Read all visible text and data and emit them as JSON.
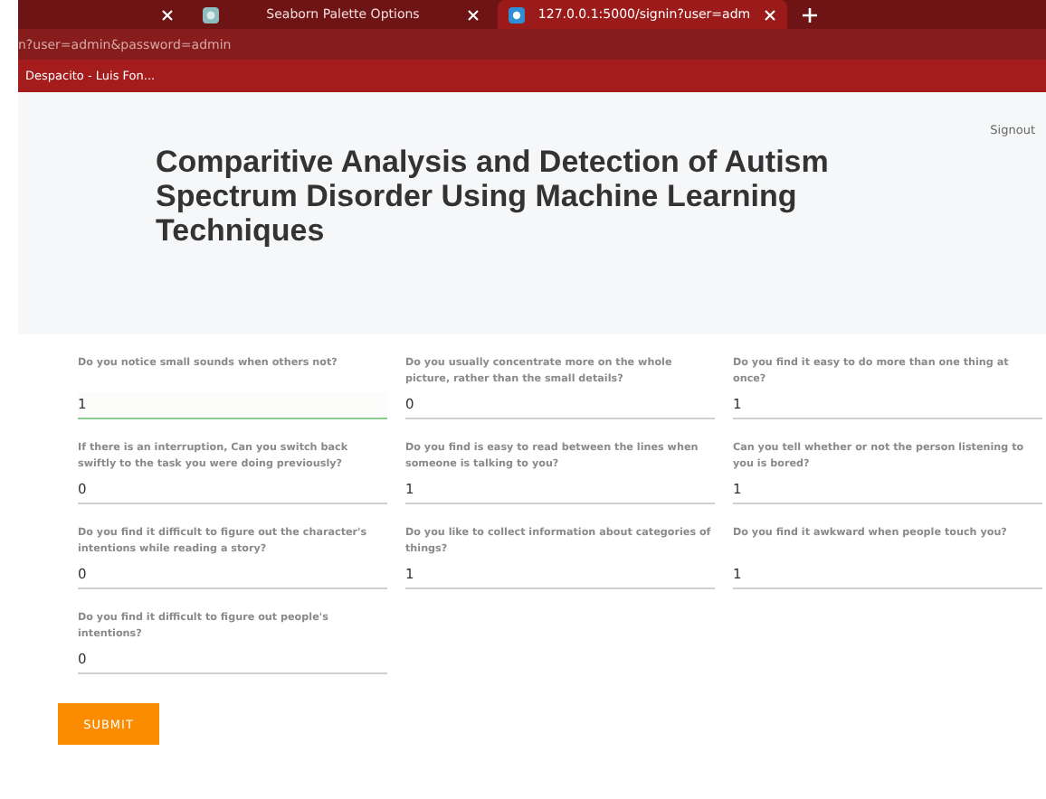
{
  "tabs": [
    {
      "selected": false
    },
    {
      "title": "Seaborn Palette Options",
      "selected": false
    },
    {
      "title": "127.0.0.1:5000/signin?user=adm",
      "selected": true
    }
  ],
  "address": "n?user=admin&password=admin",
  "bookmarks": [
    "Despacito - Luis Fon..."
  ],
  "signout": "Signout",
  "title": "Comparitive Analysis and Detection of Autism Spectrum Disorder Using Machine Learning Techniques",
  "questions": [
    {
      "label": "Do you notice small sounds when others not?",
      "value": "1",
      "focused": true
    },
    {
      "label": "Do you usually concentrate more on the whole picture, rather than the small details?",
      "value": "0",
      "focused": false
    },
    {
      "label": "Do you find it easy to do more than one thing at once?",
      "value": "1",
      "focused": false
    },
    {
      "label": "If there is an interruption, Can you switch back swiftly to the task you were doing previously?",
      "value": "0",
      "focused": false
    },
    {
      "label": "Do you find is easy to read between the lines when someone is talking to you?",
      "value": "1",
      "focused": false
    },
    {
      "label": "Can you tell whether or not the person listening to you is bored?",
      "value": "1",
      "focused": false
    },
    {
      "label": "Do you find it difficult to figure out the character's intentions while reading a story?",
      "value": "0",
      "focused": false
    },
    {
      "label": "Do you like to collect information about categories of things?",
      "value": "1",
      "focused": false
    },
    {
      "label": "Do you find it awkward when people touch you?",
      "value": "1",
      "focused": false
    },
    {
      "label": "Do you find it difficult to figure out people's intentions?",
      "value": "0",
      "focused": false
    }
  ],
  "submit": "SUBMIT"
}
